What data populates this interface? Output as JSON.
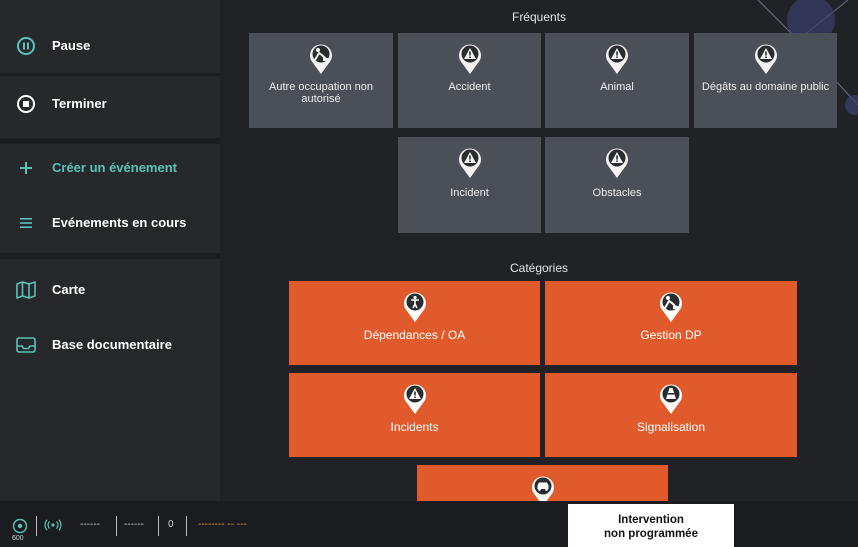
{
  "sidebar": {
    "items": [
      {
        "label": "Pause"
      },
      {
        "label": "Terminer"
      },
      {
        "label": "Créer un événement"
      },
      {
        "label": "Evénements en cours"
      },
      {
        "label": "Carte"
      },
      {
        "label": "Base documentaire"
      }
    ]
  },
  "frequents": {
    "title": "Fréquents",
    "tiles": [
      {
        "label": "Autre occupation non autorisé",
        "icon": "worker-icon"
      },
      {
        "label": "Accident",
        "icon": "warning-pin-icon"
      },
      {
        "label": "Animal",
        "icon": "warning-pin-icon"
      },
      {
        "label": "Dégâts au domaine public",
        "icon": "warning-pin-icon"
      },
      {
        "label": "Incident",
        "icon": "warning-pin-icon"
      },
      {
        "label": "Obstacles",
        "icon": "warning-pin-icon"
      }
    ]
  },
  "categories": {
    "title": "Catégories",
    "tiles": [
      {
        "label": "Dépendances / OA",
        "icon": "pedestrian-pin-icon"
      },
      {
        "label": "Gestion DP",
        "icon": "worker-pin-icon"
      },
      {
        "label": "Incidents",
        "icon": "warning-pin-icon"
      },
      {
        "label": "Signalisation",
        "icon": "cone-pin-icon"
      },
      {
        "label": "",
        "icon": "car-pin-icon"
      }
    ]
  },
  "footer": {
    "gps_value": "600",
    "field1": "------",
    "field2": "------",
    "count": "0",
    "time": "-------- -- ---",
    "intervention_line1": "Intervention",
    "intervention_line2": "non programmée"
  },
  "colors": {
    "accent": "#59c3b8",
    "category": "#e05a2b",
    "tile": "#4b4f57",
    "time_text": "#e0a02a"
  }
}
